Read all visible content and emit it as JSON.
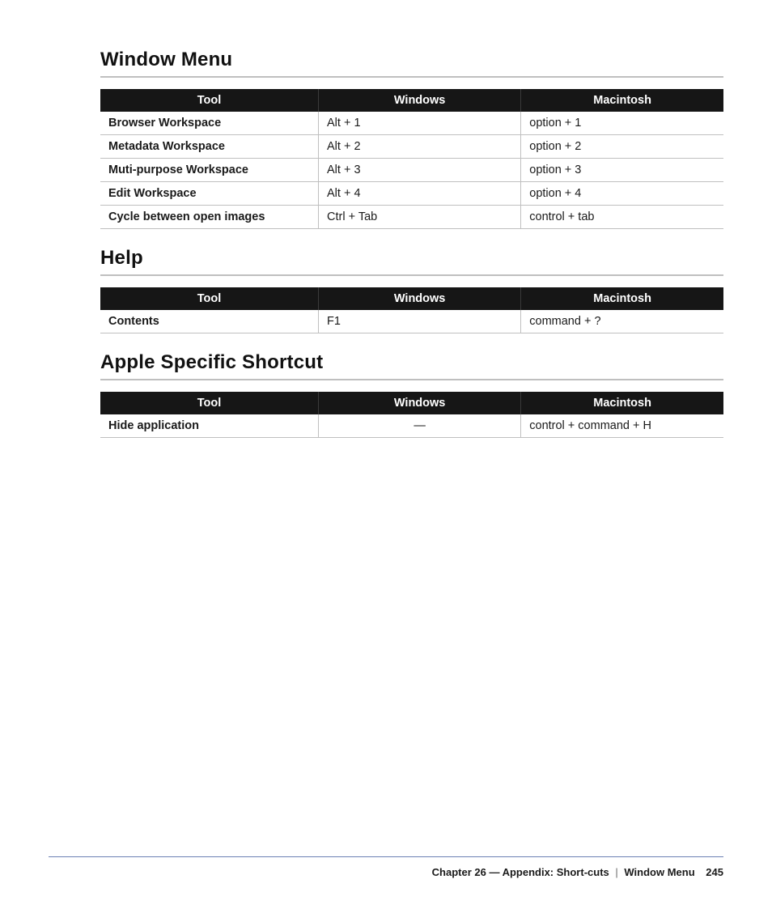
{
  "sections": [
    {
      "heading": "Window Menu",
      "columns": [
        "Tool",
        "Windows",
        "Macintosh"
      ],
      "rows": [
        {
          "tool": "Browser Workspace",
          "windows": "Alt + 1",
          "mac": "option + 1"
        },
        {
          "tool": "Metadata Workspace",
          "windows": "Alt + 2",
          "mac": "option + 2"
        },
        {
          "tool": "Muti-purpose Workspace",
          "windows": "Alt + 3",
          "mac": "option + 3"
        },
        {
          "tool": "Edit Workspace",
          "windows": "Alt + 4",
          "mac": "option + 4"
        },
        {
          "tool": "Cycle between open images",
          "windows": "Ctrl + Tab",
          "mac": "control + tab"
        }
      ]
    },
    {
      "heading": "Help",
      "columns": [
        "Tool",
        "Windows",
        "Macintosh"
      ],
      "rows": [
        {
          "tool": "Contents",
          "windows": "F1",
          "mac": "command + ?"
        }
      ]
    },
    {
      "heading": "Apple Specific Shortcut",
      "columns": [
        "Tool",
        "Windows",
        "Macintosh"
      ],
      "rows": [
        {
          "tool": "Hide application",
          "windows": "—",
          "windows_centered": true,
          "mac": "control + command + H"
        }
      ]
    }
  ],
  "footer": {
    "chapter": "Chapter 26 — Appendix: Short-cuts",
    "separator": "|",
    "subsection": "Window Menu",
    "page": "245"
  }
}
